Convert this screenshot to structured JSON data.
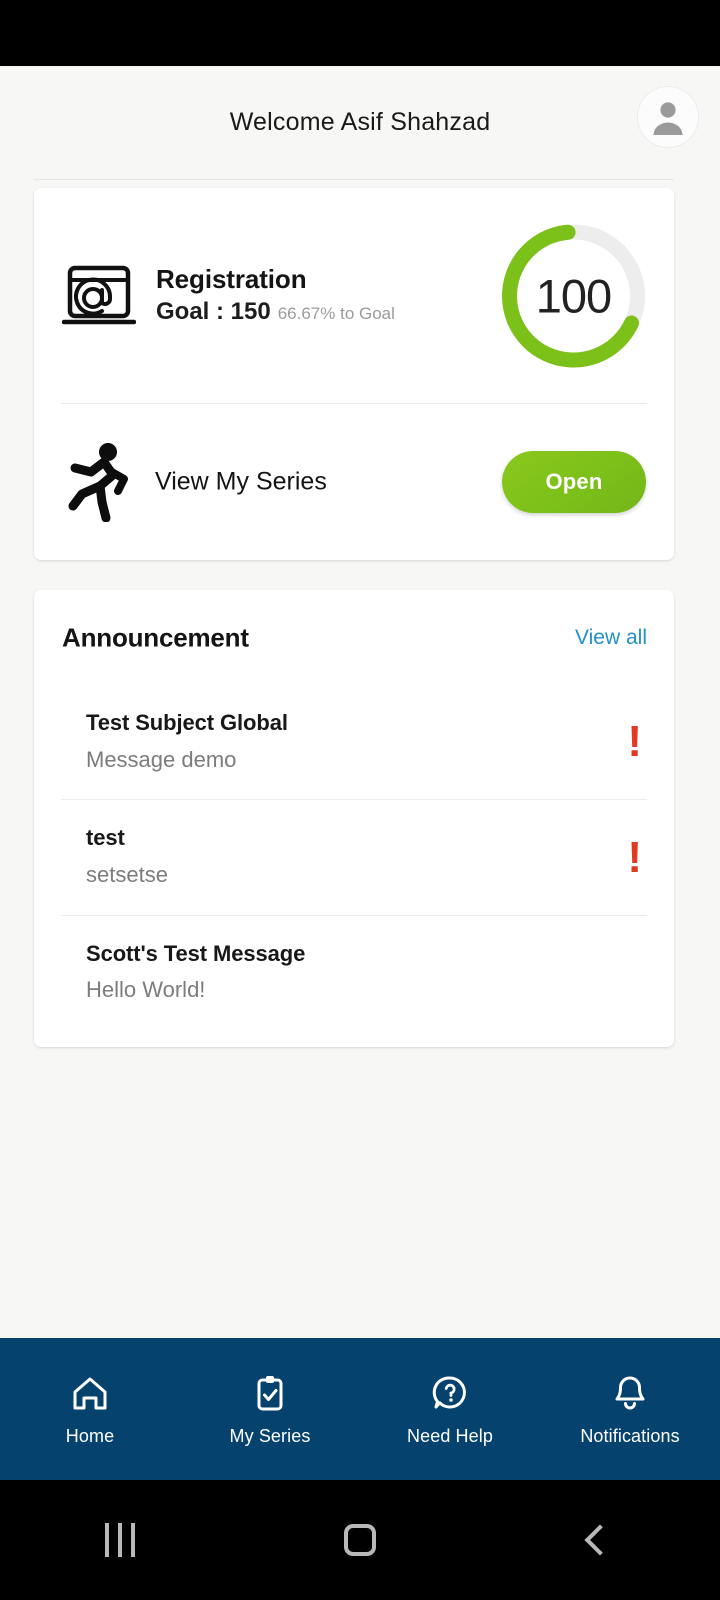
{
  "statusbar": {
    "present": true
  },
  "header": {
    "title": "Welcome Asif Shahzad",
    "avatar_icon": "person-avatar-icon"
  },
  "summary": {
    "registration": {
      "icon": "registration-at-window-icon",
      "title": "Registration",
      "goal_label": "Goal : 150",
      "percent_label": "66.67% to Goal",
      "gauge_value": "100",
      "gauge_percent": 66.67,
      "gauge_color": "#7cc01a",
      "gauge_track_color": "#ededed"
    },
    "series": {
      "icon": "running-person-icon",
      "label": "View My Series",
      "button_label": "Open",
      "button_color": "#7cc01a"
    }
  },
  "announcement": {
    "title": "Announcement",
    "view_all_label": "View all",
    "view_all_color": "#2191c8",
    "alert_color": "#e03a22",
    "items": [
      {
        "subject": "Test Subject Global",
        "message": "Message demo",
        "alert": "!"
      },
      {
        "subject": "test",
        "message": "setsetse",
        "alert": "!"
      },
      {
        "subject": "Scott's Test Message",
        "message": "Hello World!",
        "alert": ""
      }
    ]
  },
  "bottom_nav": {
    "background_color": "#06426e",
    "items": [
      {
        "label": "Home",
        "icon": "home-icon"
      },
      {
        "label": "My Series",
        "icon": "clipboard-check-icon"
      },
      {
        "label": "Need Help",
        "icon": "question-bubble-icon"
      },
      {
        "label": "Notifications",
        "icon": "bell-icon"
      }
    ]
  },
  "system_nav": {
    "recents_icon": "recents-icon",
    "home_icon": "home-square-icon",
    "back_icon": "back-chevron-icon"
  }
}
